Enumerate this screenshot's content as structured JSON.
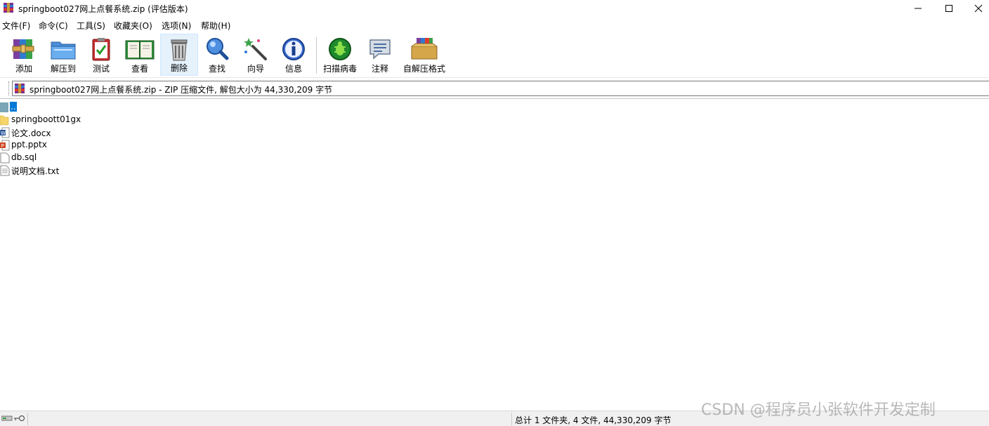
{
  "window": {
    "title": "springboot027网上点餐系统.zip (评估版本)",
    "controls": [
      "minimize",
      "maximize",
      "close"
    ]
  },
  "menu": [
    {
      "label": "文件(F)"
    },
    {
      "label": "命令(C)"
    },
    {
      "label": "工具(S)"
    },
    {
      "label": "收藏夹(O)"
    },
    {
      "label": "选项(N)"
    },
    {
      "label": "帮助(H)"
    }
  ],
  "toolbar": [
    {
      "label": "添加",
      "icon": "winrar-add-icon"
    },
    {
      "label": "解压到",
      "icon": "folder-extract-icon"
    },
    {
      "label": "测试",
      "icon": "clipboard-test-icon"
    },
    {
      "label": "查看",
      "icon": "book-view-icon"
    },
    {
      "label": "删除",
      "icon": "trash-delete-icon"
    },
    {
      "label": "查找",
      "icon": "magnifier-find-icon"
    },
    {
      "label": "向导",
      "icon": "magic-wand-icon"
    },
    {
      "label": "信息",
      "icon": "info-icon"
    },
    {
      "label": "扫描病毒",
      "icon": "virus-scan-icon"
    },
    {
      "label": "注释",
      "icon": "comment-icon"
    },
    {
      "label": "自解压格式",
      "icon": "sfx-box-icon"
    }
  ],
  "address": {
    "text": "springboot027网上点餐系统.zip - ZIP 压缩文件, 解包大小为 44,330,209 字节"
  },
  "files": [
    {
      "name": "..",
      "type": "parent"
    },
    {
      "name": "springboott01gx",
      "type": "folder"
    },
    {
      "name": "论文.docx",
      "type": "docx"
    },
    {
      "name": "ppt.pptx",
      "type": "pptx"
    },
    {
      "name": "db.sql",
      "type": "file"
    },
    {
      "name": "说明文档.txt",
      "type": "txt"
    }
  ],
  "status": {
    "summary": "总计 1 文件夹, 4 文件, 44,330,209 字节"
  },
  "watermark": "CSDN @程序员小张软件开发定制",
  "colors": {
    "selection": "#0078d7",
    "toolbar_active_bg": "#e5f1fb",
    "status_bg": "#f0f0f0"
  }
}
